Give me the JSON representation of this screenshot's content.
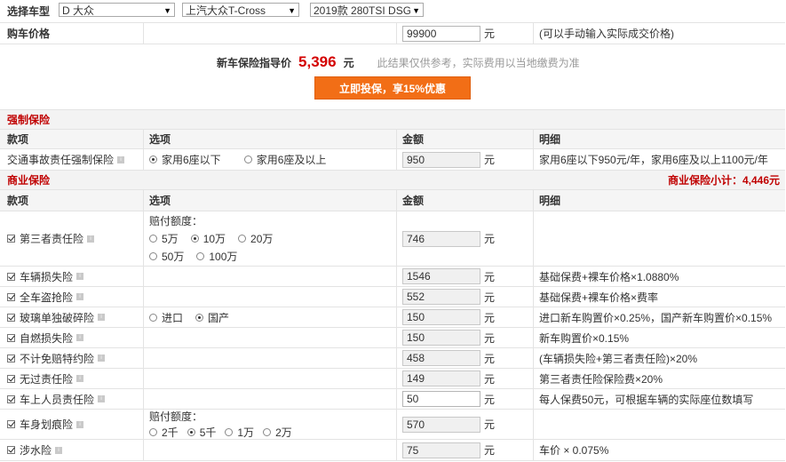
{
  "car": {
    "label": "选择车型",
    "brand": "D 大众",
    "series": "上汽大众T-Cross",
    "model": "2019款 280TSI DSG"
  },
  "price": {
    "label": "购车价格",
    "value": "99900",
    "unit": "元",
    "hint": "(可以手动输入实际成交价格)"
  },
  "guide": {
    "label": "新车保险指导价",
    "value": "5,396",
    "unit": "元",
    "note": "此结果仅供参考，实际费用以当地缴费为准",
    "button": "立即投保，享15%优惠"
  },
  "headers": {
    "item": "款项",
    "option": "选项",
    "amount": "金额",
    "detail": "明细"
  },
  "compulsory": {
    "title": "强制保险",
    "name": "交通事故责任强制保险",
    "opt1": "家用6座以下",
    "opt2": "家用6座及以上",
    "amount": "950",
    "unit": "元",
    "detail": "家用6座以下950元/年，家用6座及以上1100元/年"
  },
  "commercial": {
    "title": "商业保险",
    "subtotal": "商业保险小计：4,446元",
    "third_party": {
      "name": "第三者责任险",
      "quota_label": "赔付额度：",
      "opts": [
        "5万",
        "10万",
        "20万",
        "50万",
        "100万"
      ],
      "amount": "746",
      "unit": "元"
    },
    "damage": {
      "name": "车辆损失险",
      "amount": "1546",
      "unit": "元",
      "detail": "基础保费+裸车价格×1.0880%"
    },
    "theft": {
      "name": "全车盗抢险",
      "amount": "552",
      "unit": "元",
      "detail": "基础保费+裸车价格×费率"
    },
    "glass": {
      "name": "玻璃单独破碎险",
      "opt1": "进口",
      "opt2": "国产",
      "amount": "150",
      "unit": "元",
      "detail": "进口新车购置价×0.25%，国产新车购置价×0.15%"
    },
    "fire": {
      "name": "自燃损失险",
      "amount": "150",
      "unit": "元",
      "detail": "新车购置价×0.15%"
    },
    "deductible": {
      "name": "不计免赔特约险",
      "amount": "458",
      "unit": "元",
      "detail": "(车辆损失险+第三者责任险)×20%"
    },
    "liability": {
      "name": "无过责任险",
      "amount": "149",
      "unit": "元",
      "detail": "第三者责任险保险费×20%"
    },
    "passenger": {
      "name": "车上人员责任险",
      "amount": "50",
      "unit": "元",
      "detail": "每人保费50元，可根据车辆的实际座位数填写"
    },
    "scratch": {
      "name": "车身划痕险",
      "quota_label": "赔付额度：",
      "opts": [
        "2千",
        "5千",
        "1万",
        "2万"
      ],
      "amount": "570",
      "unit": "元"
    },
    "wading": {
      "name": "涉水险",
      "amount": "75",
      "unit": "元",
      "detail": "车价 × 0.075%"
    }
  },
  "colors": {
    "accent": "#f26e16",
    "price_red": "#d40000",
    "section_red": "#c00000"
  }
}
